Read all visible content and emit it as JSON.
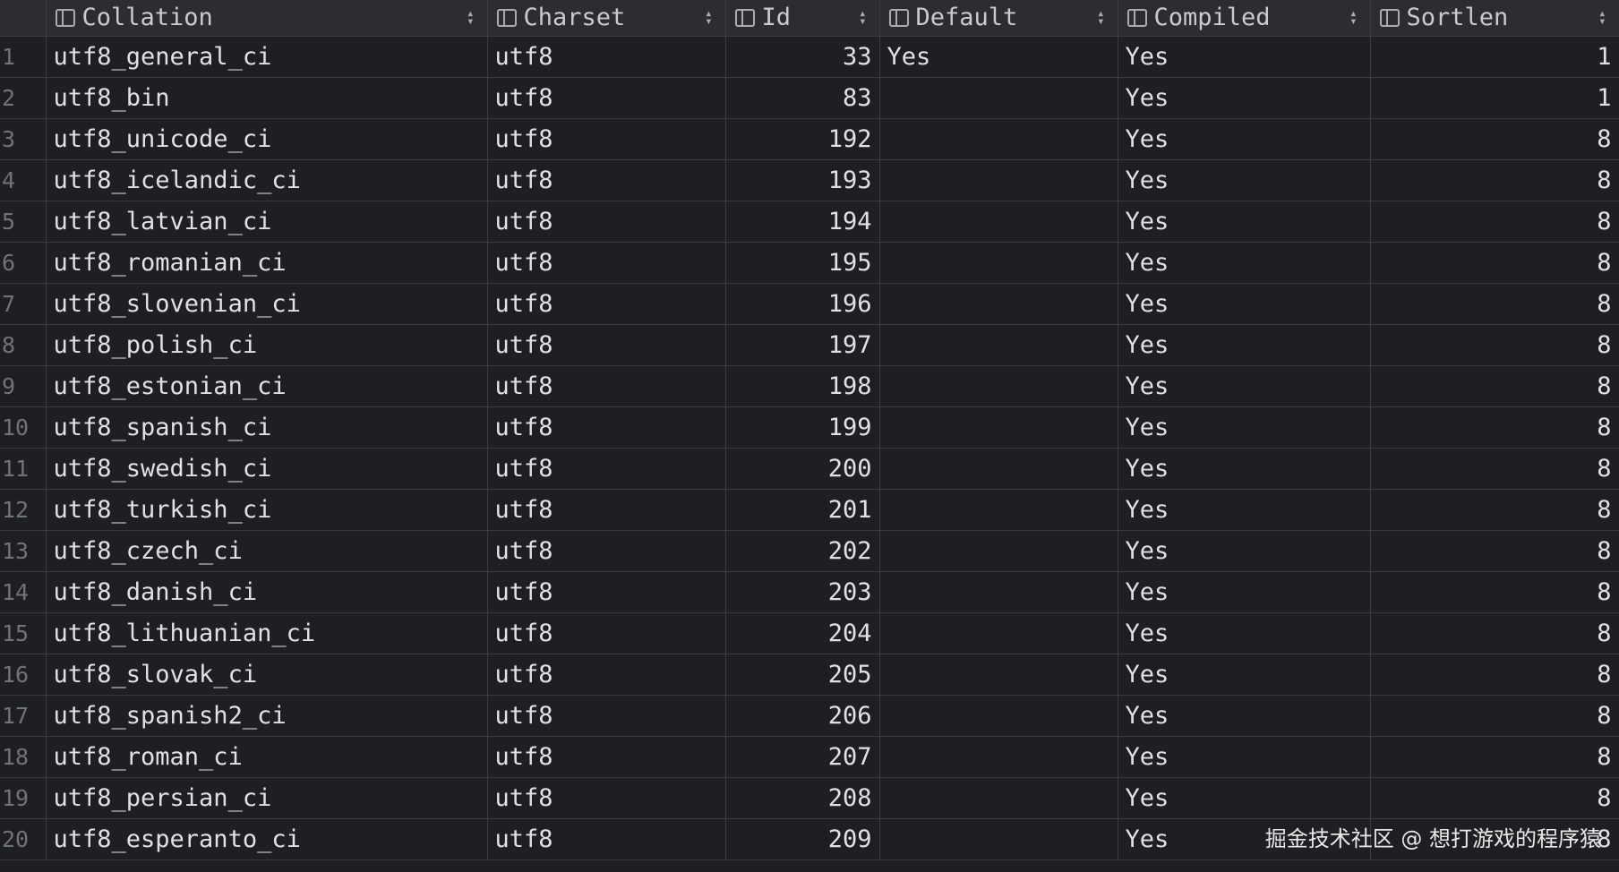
{
  "columns": [
    {
      "label": "Collation"
    },
    {
      "label": "Charset"
    },
    {
      "label": "Id"
    },
    {
      "label": "Default"
    },
    {
      "label": "Compiled"
    },
    {
      "label": "Sortlen"
    }
  ],
  "rows": [
    {
      "n": "1",
      "collation": "utf8_general_ci",
      "charset": "utf8",
      "id": "33",
      "default": "Yes",
      "compiled": "Yes",
      "sortlen": "1"
    },
    {
      "n": "2",
      "collation": "utf8_bin",
      "charset": "utf8",
      "id": "83",
      "default": "",
      "compiled": "Yes",
      "sortlen": "1"
    },
    {
      "n": "3",
      "collation": "utf8_unicode_ci",
      "charset": "utf8",
      "id": "192",
      "default": "",
      "compiled": "Yes",
      "sortlen": "8"
    },
    {
      "n": "4",
      "collation": "utf8_icelandic_ci",
      "charset": "utf8",
      "id": "193",
      "default": "",
      "compiled": "Yes",
      "sortlen": "8"
    },
    {
      "n": "5",
      "collation": "utf8_latvian_ci",
      "charset": "utf8",
      "id": "194",
      "default": "",
      "compiled": "Yes",
      "sortlen": "8"
    },
    {
      "n": "6",
      "collation": "utf8_romanian_ci",
      "charset": "utf8",
      "id": "195",
      "default": "",
      "compiled": "Yes",
      "sortlen": "8"
    },
    {
      "n": "7",
      "collation": "utf8_slovenian_ci",
      "charset": "utf8",
      "id": "196",
      "default": "",
      "compiled": "Yes",
      "sortlen": "8"
    },
    {
      "n": "8",
      "collation": "utf8_polish_ci",
      "charset": "utf8",
      "id": "197",
      "default": "",
      "compiled": "Yes",
      "sortlen": "8"
    },
    {
      "n": "9",
      "collation": "utf8_estonian_ci",
      "charset": "utf8",
      "id": "198",
      "default": "",
      "compiled": "Yes",
      "sortlen": "8"
    },
    {
      "n": "10",
      "collation": "utf8_spanish_ci",
      "charset": "utf8",
      "id": "199",
      "default": "",
      "compiled": "Yes",
      "sortlen": "8"
    },
    {
      "n": "11",
      "collation": "utf8_swedish_ci",
      "charset": "utf8",
      "id": "200",
      "default": "",
      "compiled": "Yes",
      "sortlen": "8"
    },
    {
      "n": "12",
      "collation": "utf8_turkish_ci",
      "charset": "utf8",
      "id": "201",
      "default": "",
      "compiled": "Yes",
      "sortlen": "8"
    },
    {
      "n": "13",
      "collation": "utf8_czech_ci",
      "charset": "utf8",
      "id": "202",
      "default": "",
      "compiled": "Yes",
      "sortlen": "8"
    },
    {
      "n": "14",
      "collation": "utf8_danish_ci",
      "charset": "utf8",
      "id": "203",
      "default": "",
      "compiled": "Yes",
      "sortlen": "8"
    },
    {
      "n": "15",
      "collation": "utf8_lithuanian_ci",
      "charset": "utf8",
      "id": "204",
      "default": "",
      "compiled": "Yes",
      "sortlen": "8"
    },
    {
      "n": "16",
      "collation": "utf8_slovak_ci",
      "charset": "utf8",
      "id": "205",
      "default": "",
      "compiled": "Yes",
      "sortlen": "8"
    },
    {
      "n": "17",
      "collation": "utf8_spanish2_ci",
      "charset": "utf8",
      "id": "206",
      "default": "",
      "compiled": "Yes",
      "sortlen": "8"
    },
    {
      "n": "18",
      "collation": "utf8_roman_ci",
      "charset": "utf8",
      "id": "207",
      "default": "",
      "compiled": "Yes",
      "sortlen": "8"
    },
    {
      "n": "19",
      "collation": "utf8_persian_ci",
      "charset": "utf8",
      "id": "208",
      "default": "",
      "compiled": "Yes",
      "sortlen": "8"
    },
    {
      "n": "20",
      "collation": "utf8_esperanto_ci",
      "charset": "utf8",
      "id": "209",
      "default": "",
      "compiled": "Yes",
      "sortlen": "8"
    }
  ],
  "watermark": "掘金技术社区 @ 想打游戏的程序猿",
  "colors": {
    "background": "#1e1f22",
    "header_background": "#2b2d30",
    "gridline": "#3a3c40",
    "text": "#dfe1e5",
    "row_number": "#6f737a"
  }
}
